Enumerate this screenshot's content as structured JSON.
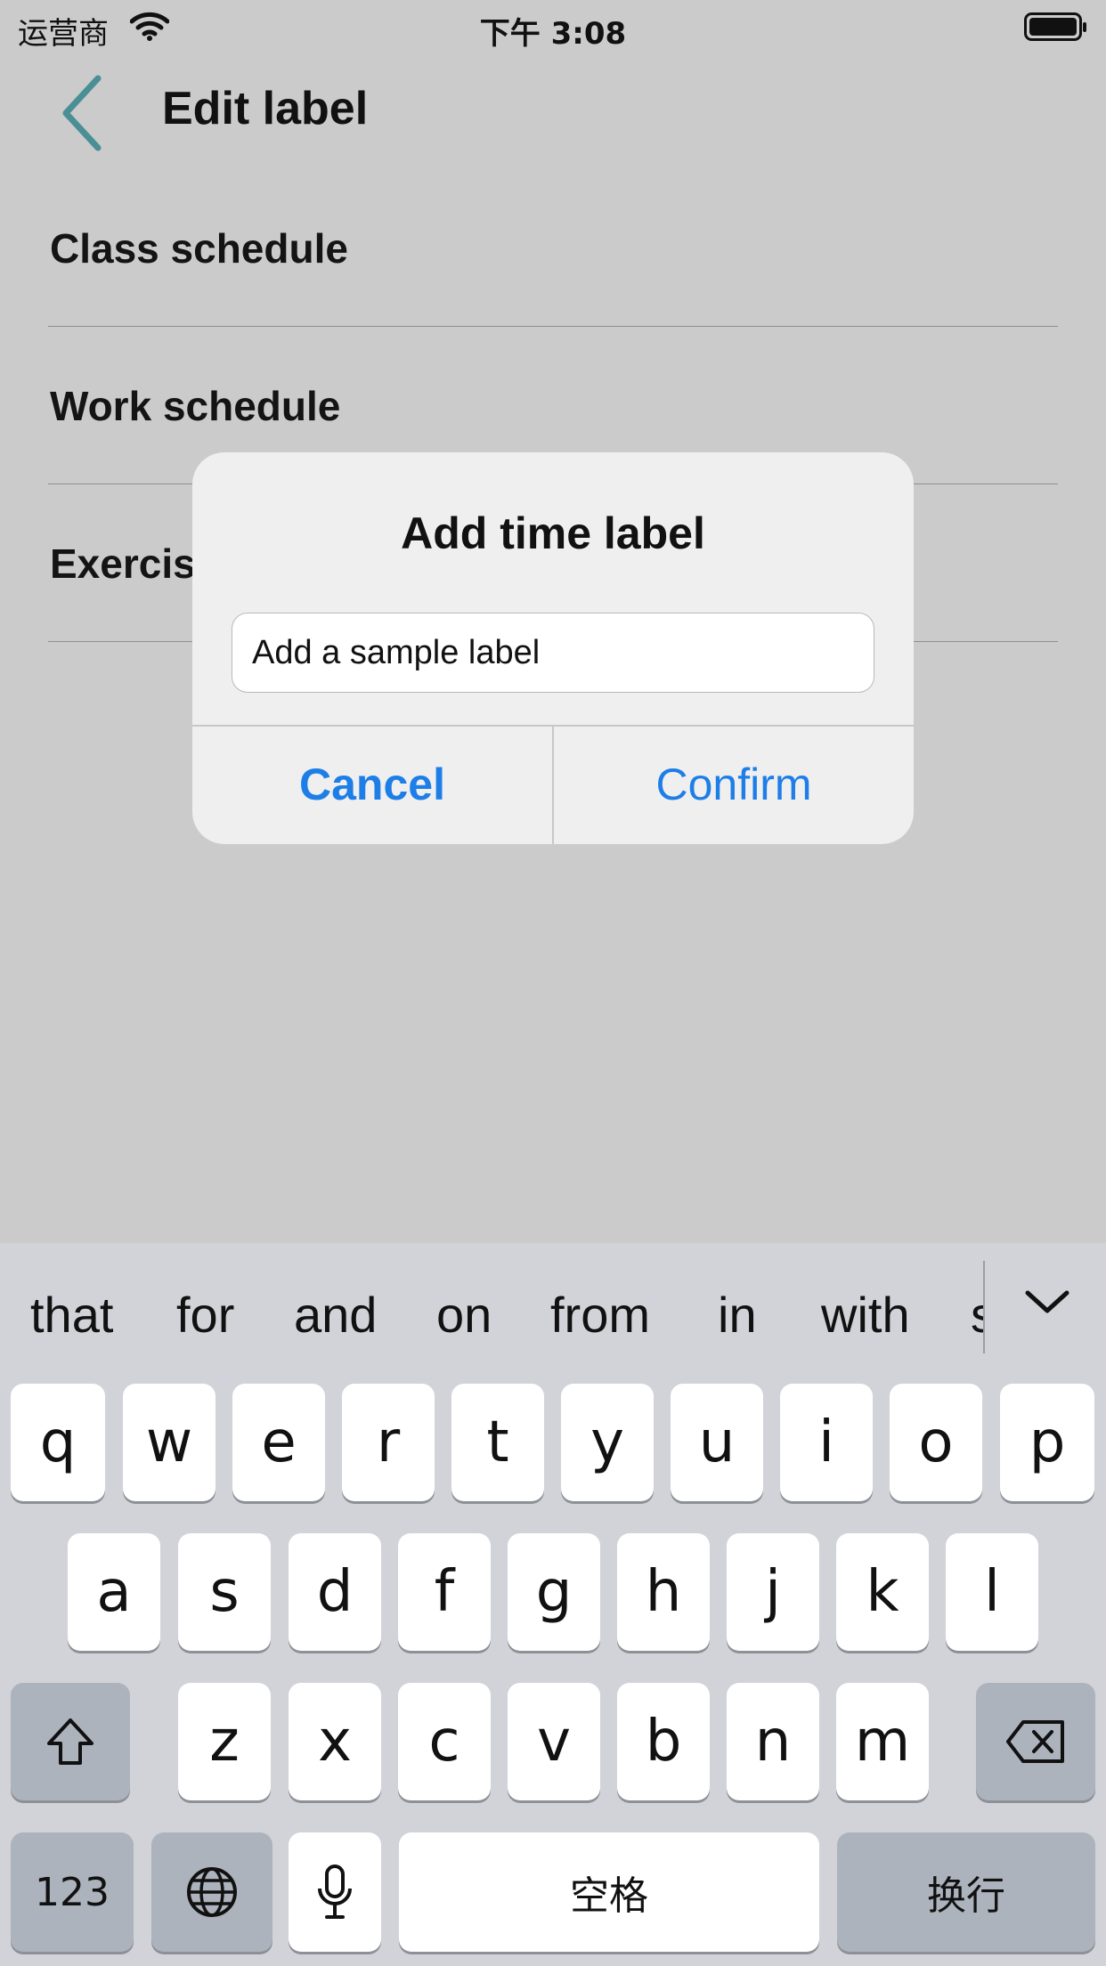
{
  "status_bar": {
    "carrier": "运营商",
    "time": "下午 3:08"
  },
  "nav": {
    "title": "Edit label"
  },
  "labels": [
    "Class schedule",
    "Work schedule",
    "Exercis"
  ],
  "dialog": {
    "title": "Add time label",
    "input_value": "Add a sample label",
    "cancel": "Cancel",
    "confirm": "Confirm"
  },
  "keyboard": {
    "suggestions": [
      "that",
      "for",
      "and",
      "on",
      "from",
      "in",
      "with",
      "s"
    ],
    "row1": [
      "q",
      "w",
      "e",
      "r",
      "t",
      "y",
      "u",
      "i",
      "o",
      "p"
    ],
    "row2": [
      "a",
      "s",
      "d",
      "f",
      "g",
      "h",
      "j",
      "k",
      "l"
    ],
    "row3": [
      "z",
      "x",
      "c",
      "v",
      "b",
      "n",
      "m"
    ],
    "numbers_key": "123",
    "space_key": "空格",
    "return_key": "换行"
  },
  "colors": {
    "accent": "#1e7ee8",
    "back_arrow": "#4a8f95"
  }
}
